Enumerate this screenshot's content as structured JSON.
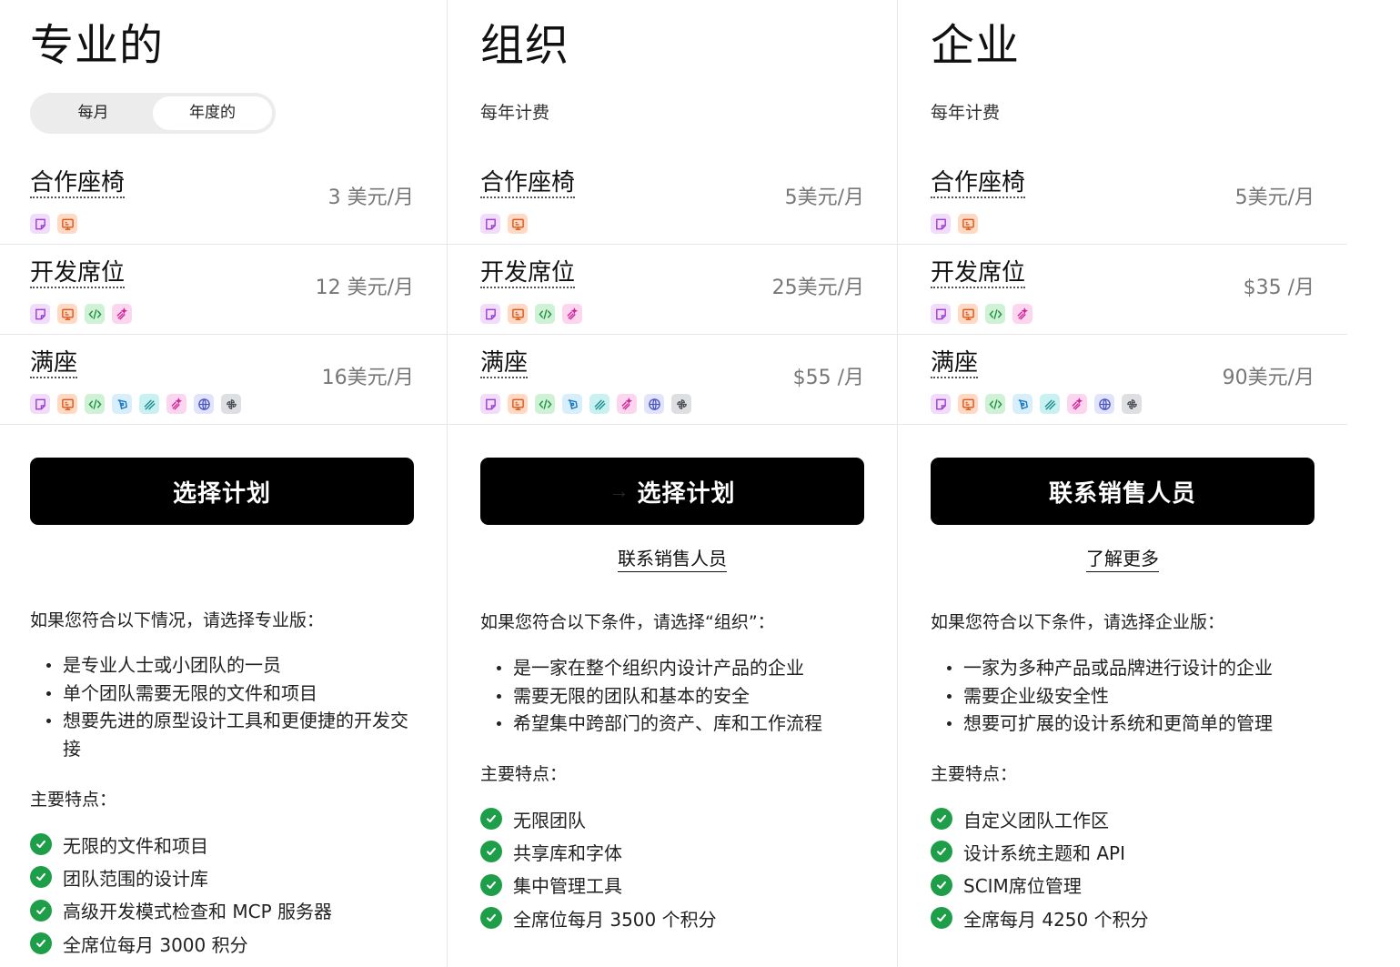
{
  "plans": [
    {
      "id": "pro",
      "title": "专业的",
      "billing_toggle": {
        "monthly": "每月",
        "annual": "年度的",
        "selected": "annual"
      },
      "seats": [
        {
          "name": "合作座椅",
          "price": "3 美元/月",
          "icons": [
            "sticky-note-icon",
            "presentation-board-icon"
          ]
        },
        {
          "name": "开发席位",
          "price": "12 美元/月",
          "icons": [
            "sticky-note-icon",
            "presentation-board-icon",
            "code-icon",
            "sparkle-brush-icon"
          ]
        },
        {
          "name": "满座",
          "price": "16美元/月",
          "icons": [
            "sticky-note-icon",
            "presentation-board-icon",
            "code-icon",
            "pen-nib-icon",
            "scribble-icon",
            "sparkle-brush-icon",
            "globe-icon",
            "pinwheel-icon"
          ]
        }
      ],
      "cta": "选择计划",
      "intro": "如果您符合以下情况，请选择专业版：",
      "bullets": [
        "是专业人士或小团队的一员",
        "单个团队需要无限的文件和项目",
        "想要先进的原型设计工具和更便捷的开发交接"
      ],
      "features_heading": "主要特点：",
      "features": [
        "无限的文件和项目",
        "团队范围的设计库",
        "高级开发模式检查和 MCP 服务器",
        "全席位每月 3000 积分"
      ]
    },
    {
      "id": "org",
      "title": "组织",
      "billing_note": "每年计费",
      "seats": [
        {
          "name": "合作座椅",
          "price": "5美元/月",
          "icons": [
            "sticky-note-icon",
            "presentation-board-icon"
          ]
        },
        {
          "name": "开发席位",
          "price": "25美元/月",
          "icons": [
            "sticky-note-icon",
            "presentation-board-icon",
            "code-icon",
            "sparkle-brush-icon"
          ]
        },
        {
          "name": "满座",
          "price": "$55 /月",
          "icons": [
            "sticky-note-icon",
            "presentation-board-icon",
            "code-icon",
            "pen-nib-icon",
            "scribble-icon",
            "sparkle-brush-icon",
            "globe-icon",
            "pinwheel-icon"
          ]
        }
      ],
      "cta": "选择计划",
      "secondary_link": "联系销售人员",
      "intro": "如果您符合以下条件，请选择“组织”：",
      "bullets": [
        "是一家在整个组织内设计产品的企业",
        "需要无限的团队和基本的安全",
        "希望集中跨部门的资产、库和工作流程"
      ],
      "features_heading": "主要特点：",
      "features": [
        "无限团队",
        "共享库和字体",
        "集中管理工具",
        "全席位每月 3500 个积分"
      ]
    },
    {
      "id": "enterprise",
      "title": "企业",
      "billing_note": "每年计费",
      "seats": [
        {
          "name": "合作座椅",
          "price": "5美元/月",
          "icons": [
            "sticky-note-icon",
            "presentation-board-icon"
          ]
        },
        {
          "name": "开发席位",
          "price": "$35 /月",
          "icons": [
            "sticky-note-icon",
            "presentation-board-icon",
            "code-icon",
            "sparkle-brush-icon"
          ]
        },
        {
          "name": "满座",
          "price": "90美元/月",
          "icons": [
            "sticky-note-icon",
            "presentation-board-icon",
            "code-icon",
            "pen-nib-icon",
            "scribble-icon",
            "sparkle-brush-icon",
            "globe-icon",
            "pinwheel-icon"
          ]
        }
      ],
      "cta": "联系销售人员",
      "secondary_link": "了解更多",
      "intro": "如果您符合以下条件，请选择企业版：",
      "bullets": [
        "一家为多种产品或品牌进行设计的企业",
        "需要企业级安全性",
        "想要可扩展的设计系统和更简单的管理"
      ],
      "features_heading": "主要特点：",
      "features": [
        "自定义团队工作区",
        "设计系统主题和 API",
        "SCIM席位管理",
        "全席每月 4250 个积分"
      ]
    }
  ],
  "colors": {
    "cta_bg": "#000000",
    "check_green": "#1f9e4a",
    "divider": "#e6e6e6"
  }
}
